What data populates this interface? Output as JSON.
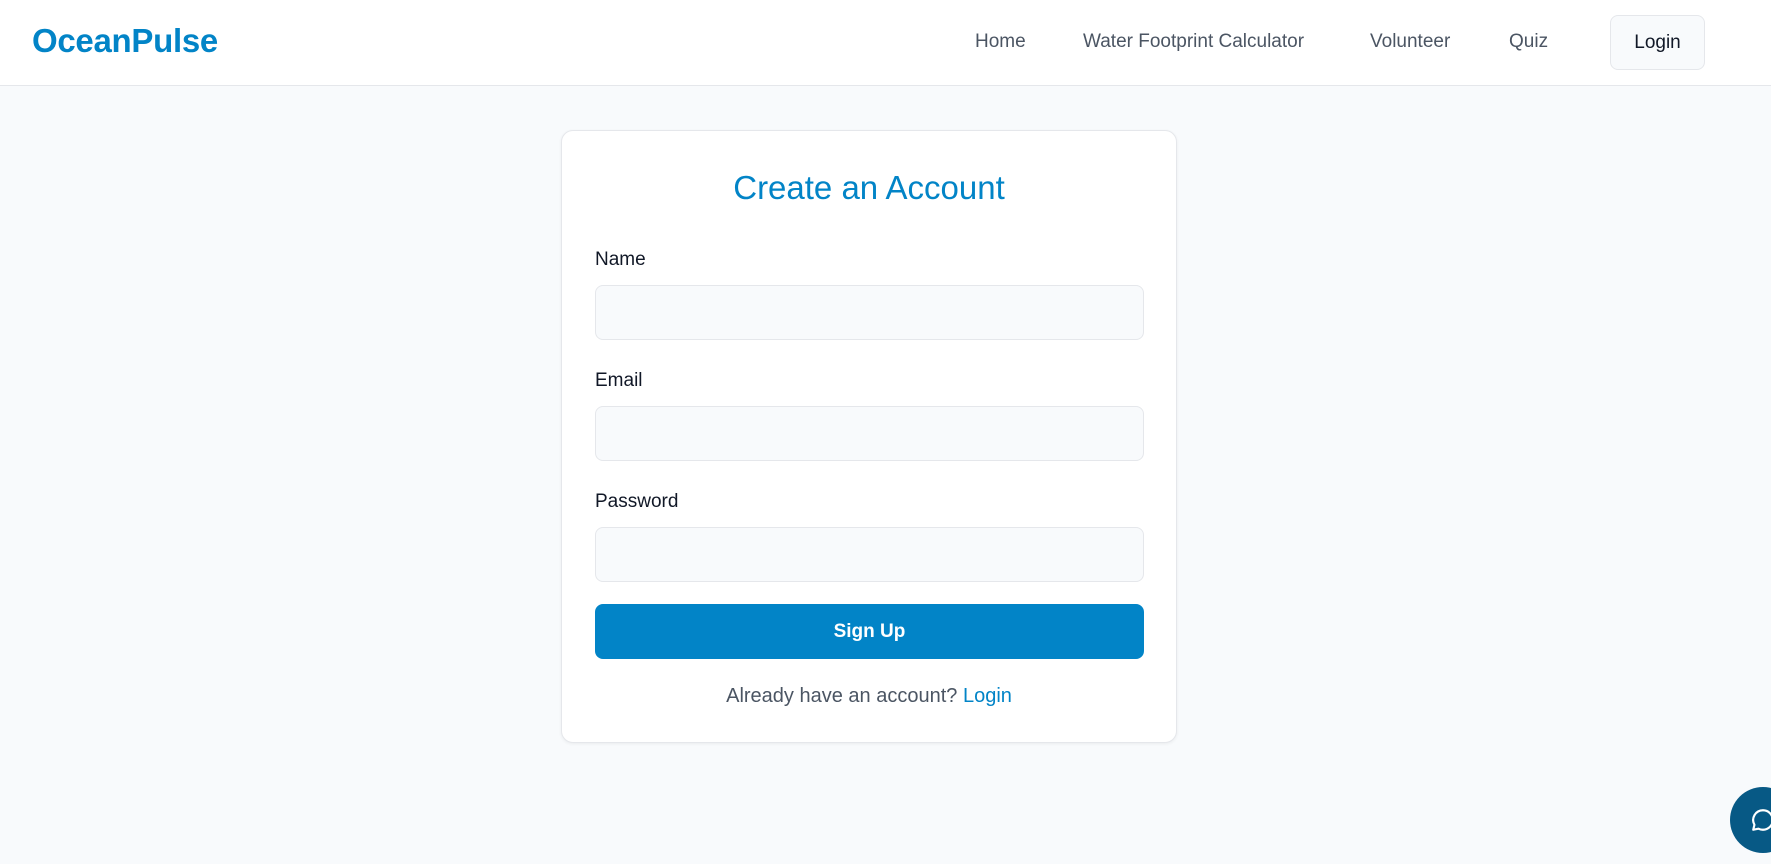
{
  "header": {
    "brand": "OceanPulse",
    "nav": [
      {
        "label": "Home"
      },
      {
        "label": "Water Footprint Calculator"
      },
      {
        "label": "Volunteer"
      },
      {
        "label": "Quiz"
      }
    ],
    "login_label": "Login"
  },
  "form": {
    "title": "Create an Account",
    "fields": [
      {
        "label": "Name",
        "value": "",
        "placeholder": ""
      },
      {
        "label": "Email",
        "value": "",
        "placeholder": ""
      },
      {
        "label": "Password",
        "value": "",
        "placeholder": ""
      }
    ],
    "submit_label": "Sign Up",
    "footer_text": "Already have an account?",
    "footer_link": "Login"
  },
  "chat": {
    "icon": "chat-bubble-icon"
  },
  "colors": {
    "accent": "#0284c7",
    "accent_dark": "#075985",
    "background": "#f8fafc",
    "card": "#ffffff",
    "border": "#e5e7eb"
  }
}
